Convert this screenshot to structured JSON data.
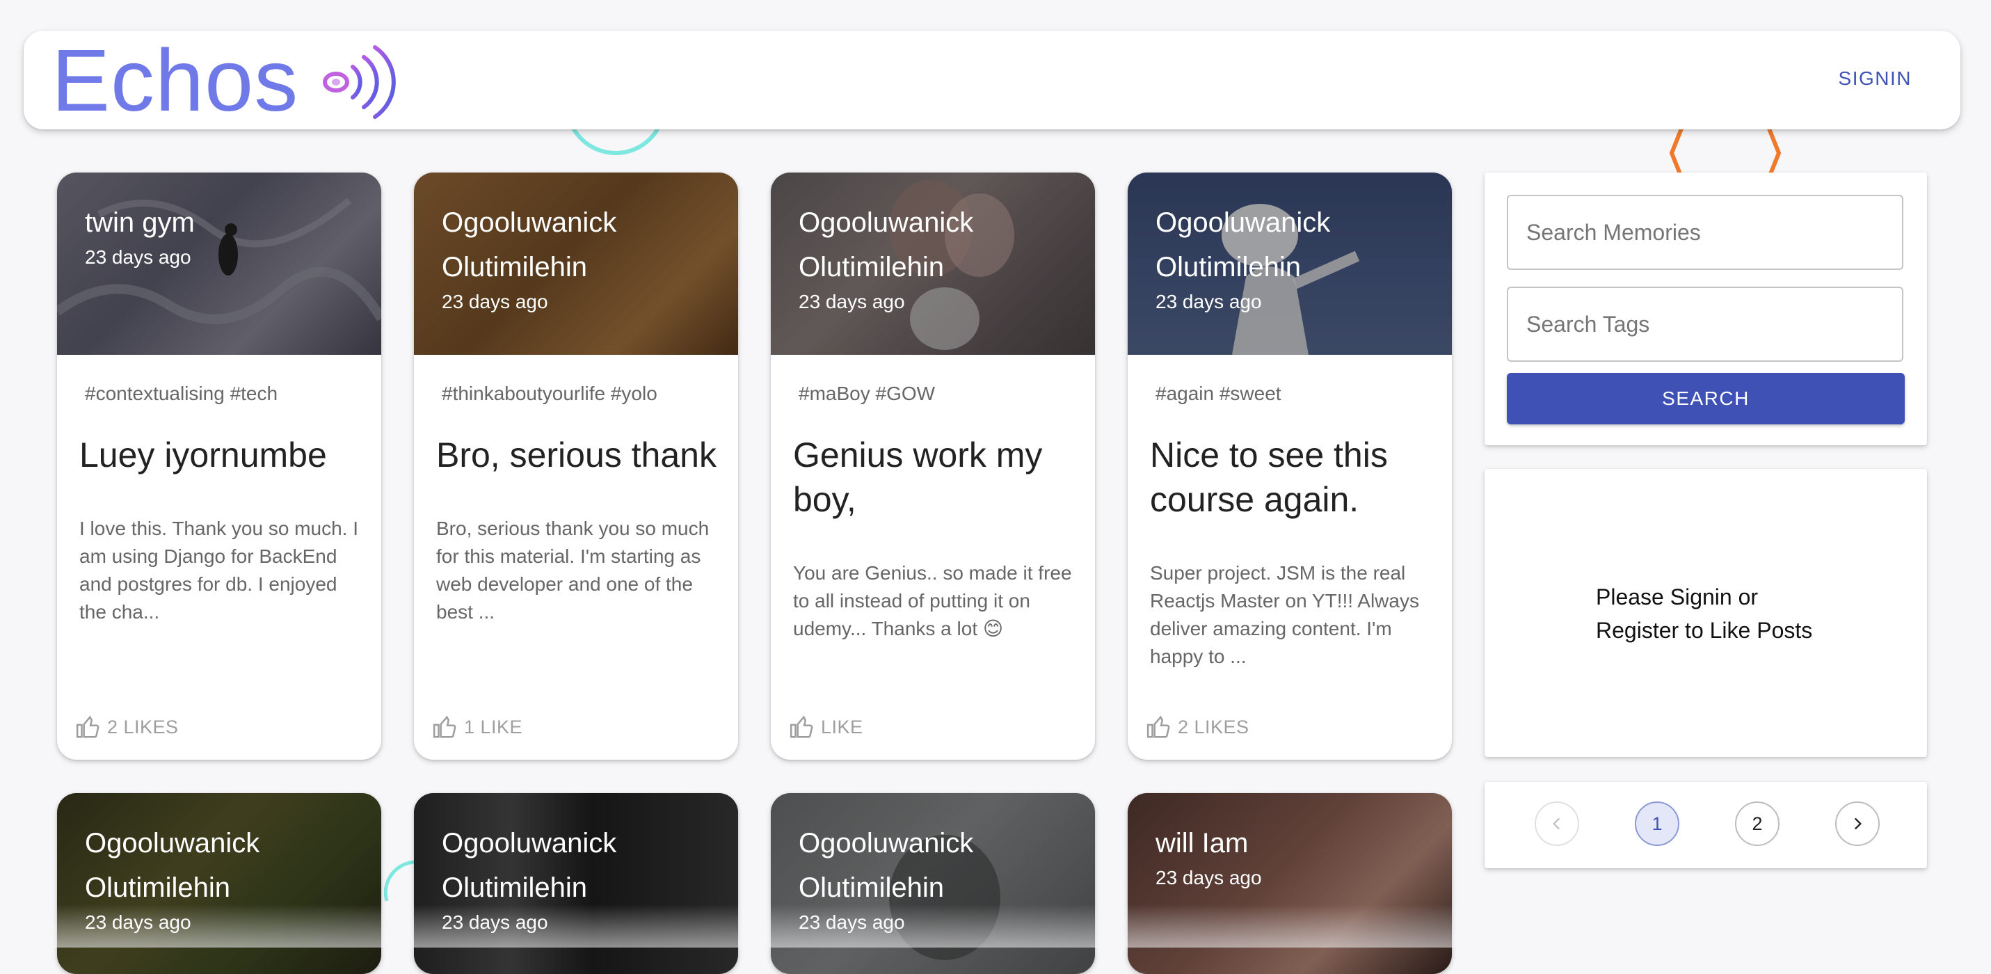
{
  "header": {
    "brand": "Echos",
    "brand_logo_icon": "sound-waves-icon",
    "signin_label": "SIGNIN",
    "brand_color": "#6f7ae8",
    "accent_color": "#3f51b5"
  },
  "posts": [
    {
      "author": "twin gym",
      "time": "23 days ago",
      "tags": "#contextualising #tech",
      "title": "Luey iyornumbe",
      "message": "I love this. Thank you so much. I am using Django for BackEnd and postgres for db. I enjoyed the cha...",
      "likes": "2 LIKES"
    },
    {
      "author": "Ogooluwanick Olutimilehin",
      "time": "23 days ago",
      "tags": "#thinkaboutyourlife #yolo",
      "title": "Bro, serious thank",
      "message": "Bro, serious thank you so much for this material. I'm starting as web developer and one of the best ...",
      "likes": "1 LIKE"
    },
    {
      "author": "Ogooluwanick Olutimilehin",
      "time": "23 days ago",
      "tags": "#maBoy #GOW",
      "title": "Genius work my boy,",
      "message": "You are Genius.. so made it free to all instead of putting it on udemy... Thanks a lot 😊",
      "likes": "LIKE"
    },
    {
      "author": "Ogooluwanick Olutimilehin",
      "time": "23 days ago",
      "tags": "#again #sweet",
      "title": "Nice to see this course again.",
      "message": "Super project. JSM is the real Reactjs Master on YT!!! Always deliver amazing content. I'm happy to ...",
      "likes": "2 LIKES"
    },
    {
      "author": "Ogooluwanick Olutimilehin",
      "time": "23 days ago"
    },
    {
      "author": "Ogooluwanick Olutimilehin",
      "time": "23 days ago"
    },
    {
      "author": "Ogooluwanick Olutimilehin",
      "time": "23 days ago"
    },
    {
      "author": "will Iam",
      "time": "23 days ago"
    }
  ],
  "search": {
    "memories_placeholder": "Search Memories",
    "tags_placeholder": "Search Tags",
    "button_label": "SEARCH"
  },
  "signin_prompt": "Please Signin or Register to Like Posts",
  "pagination": {
    "pages": [
      "1",
      "2"
    ],
    "current": "1",
    "prev_icon": "chevron-left-icon",
    "next_icon": "chevron-right-icon"
  },
  "icons": {
    "like": "thumb-up-icon"
  }
}
